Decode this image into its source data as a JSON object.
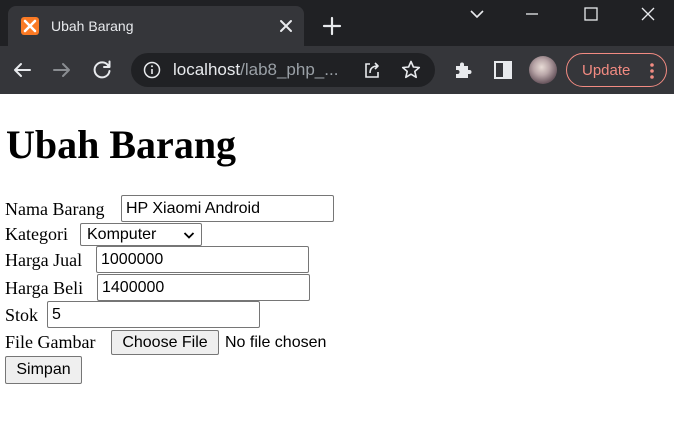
{
  "browser": {
    "tab": {
      "title": "Ubah Barang",
      "favicon": "xampp-icon"
    },
    "address": {
      "host": "localhost",
      "path": "/lab8_php_..."
    },
    "update_label": "Update",
    "colors": {
      "frame": "#202124",
      "toolbar": "#35363a",
      "update_accent": "#f28b82",
      "favicon": "#fb7a24"
    }
  },
  "page": {
    "heading": "Ubah Barang",
    "form": {
      "nama_barang": {
        "label": "Nama Barang",
        "value": "HP Xiaomi Android"
      },
      "kategori": {
        "label": "Kategori",
        "selected": "Komputer"
      },
      "harga_jual": {
        "label": "Harga Jual",
        "value": "1000000"
      },
      "harga_beli": {
        "label": "Harga Beli",
        "value": "1400000"
      },
      "stok": {
        "label": "Stok",
        "value": "5"
      },
      "file_gambar": {
        "label": "File Gambar",
        "button": "Choose File",
        "status": "No file chosen"
      },
      "submit": "Simpan"
    }
  }
}
